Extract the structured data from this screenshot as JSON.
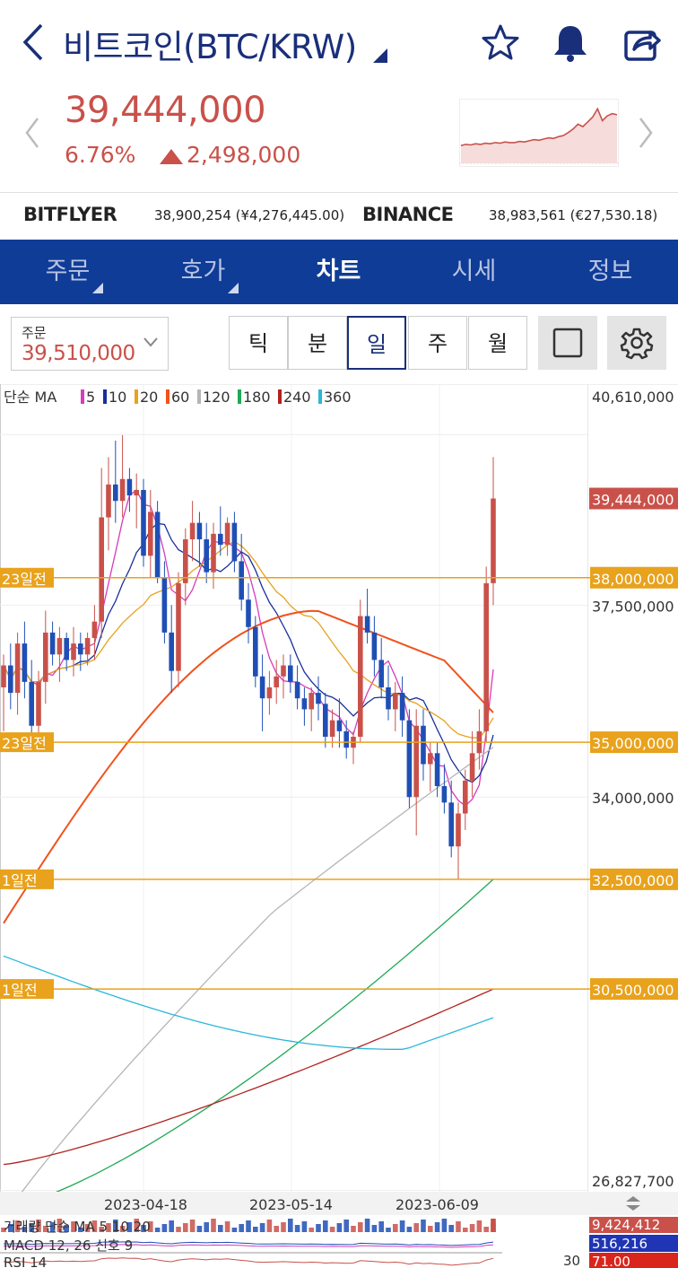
{
  "header": {
    "back_icon": "chevron-left-icon",
    "title": "비트코인(BTC/KRW)",
    "icons": [
      "star-icon",
      "bell-icon",
      "share-icon"
    ],
    "color": "#1a2f7a"
  },
  "price": {
    "current": "39,444,000",
    "change_pct": "6.76%",
    "change_amount": "2,498,000",
    "up_color": "#c9514a"
  },
  "exchanges": [
    {
      "name": "BITFLYER",
      "value": "38,900,254 (¥4,276,445.00)"
    },
    {
      "name": "BINANCE",
      "value": "38,983,561 (€27,530.18)"
    }
  ],
  "tabs": [
    {
      "label": "주문",
      "caret": true
    },
    {
      "label": "호가",
      "caret": true
    },
    {
      "label": "차트",
      "active": true
    },
    {
      "label": "시세"
    },
    {
      "label": "정보"
    }
  ],
  "order_select": {
    "label": "주문",
    "value": "39,510,000"
  },
  "periods": [
    {
      "label": "틱"
    },
    {
      "label": "분"
    },
    {
      "label": "일",
      "selected": true
    },
    {
      "label": "주"
    },
    {
      "label": "월"
    }
  ],
  "tool_icons": [
    "square-icon",
    "gear-icon"
  ],
  "chart_data": {
    "type": "candlestick",
    "legend": {
      "prefix": "단순 MA",
      "items": [
        {
          "label": "5",
          "color": "#d63bbd"
        },
        {
          "label": "10",
          "color": "#1a2f9a"
        },
        {
          "label": "20",
          "color": "#e8a21c"
        },
        {
          "label": "60",
          "color": "#f0521c"
        },
        {
          "label": "120",
          "color": "#b5b5b5"
        },
        {
          "label": "180",
          "color": "#1faa55"
        },
        {
          "label": "240",
          "color": "#b0231e"
        },
        {
          "label": "360",
          "color": "#2ab7d8"
        }
      ]
    },
    "y_labels": [
      {
        "text": "40,610,000",
        "value": 40610000
      },
      {
        "text": "37,500,000",
        "value": 37500000
      },
      {
        "text": "34,000,000",
        "value": 34000000
      },
      {
        "text": "26,827,700",
        "value": 26827700
      }
    ],
    "current_price": {
      "text": "39,444,000",
      "value": 39444000
    },
    "price_lines": [
      {
        "left": "23일전",
        "right": "38,000,000",
        "value": 38000000
      },
      {
        "left": "23일전",
        "right": "35,000,000",
        "value": 35000000
      },
      {
        "left": "1일전",
        "right": "32,500,000",
        "value": 32500000
      },
      {
        "left": "1일전",
        "right": "30,500,000",
        "value": 30500000
      }
    ],
    "x_labels": [
      "2023-04-18",
      "2023-05-14",
      "2023-06-09"
    ],
    "candles": [
      [
        36.0,
        36.6,
        35.2,
        36.4
      ],
      [
        36.4,
        36.8,
        35.6,
        35.9
      ],
      [
        35.9,
        37.0,
        35.5,
        36.8
      ],
      [
        36.8,
        37.2,
        35.8,
        36.1
      ],
      [
        36.1,
        36.5,
        35.0,
        35.3
      ],
      [
        35.3,
        36.3,
        34.9,
        36.1
      ],
      [
        36.1,
        37.4,
        35.7,
        37.0
      ],
      [
        37.0,
        37.2,
        36.4,
        36.6
      ],
      [
        36.6,
        37.1,
        36.1,
        36.9
      ],
      [
        36.9,
        37.0,
        36.3,
        36.5
      ],
      [
        36.5,
        37.1,
        36.2,
        36.8
      ],
      [
        36.8,
        37.0,
        36.3,
        36.6
      ],
      [
        36.6,
        37.0,
        36.4,
        36.9
      ],
      [
        36.9,
        37.5,
        36.5,
        37.2
      ],
      [
        37.2,
        40.0,
        36.9,
        39.1
      ],
      [
        39.1,
        40.2,
        38.5,
        39.7
      ],
      [
        39.7,
        40.5,
        39.0,
        39.4
      ],
      [
        39.4,
        40.6,
        39.1,
        39.8
      ],
      [
        39.8,
        40.0,
        39.2,
        39.5
      ],
      [
        39.5,
        39.9,
        38.9,
        39.6
      ],
      [
        39.6,
        39.8,
        38.2,
        38.4
      ],
      [
        38.4,
        39.6,
        38.0,
        39.2
      ],
      [
        39.2,
        39.4,
        37.9,
        38.0
      ],
      [
        38.0,
        38.3,
        36.8,
        37.0
      ],
      [
        37.0,
        37.5,
        35.9,
        36.3
      ],
      [
        36.3,
        38.1,
        36.0,
        37.9
      ],
      [
        37.9,
        38.9,
        37.5,
        38.7
      ],
      [
        38.7,
        39.4,
        38.3,
        39.0
      ],
      [
        39.0,
        39.2,
        38.2,
        38.7
      ],
      [
        38.7,
        39.0,
        37.9,
        38.1
      ],
      [
        38.1,
        39.0,
        37.8,
        38.8
      ],
      [
        38.8,
        39.3,
        38.4,
        38.6
      ],
      [
        38.6,
        39.1,
        38.4,
        39.0
      ],
      [
        39.0,
        39.2,
        38.1,
        38.3
      ],
      [
        38.3,
        38.8,
        37.4,
        37.6
      ],
      [
        37.6,
        37.9,
        36.8,
        37.1
      ],
      [
        37.1,
        37.3,
        36.0,
        36.2
      ],
      [
        36.2,
        36.6,
        35.2,
        35.8
      ],
      [
        35.8,
        36.3,
        35.5,
        36.0
      ],
      [
        36.0,
        36.5,
        35.7,
        36.2
      ],
      [
        36.2,
        36.6,
        35.8,
        36.4
      ],
      [
        36.4,
        36.6,
        35.9,
        36.1
      ],
      [
        36.1,
        36.4,
        35.6,
        35.8
      ],
      [
        35.8,
        36.0,
        35.3,
        35.6
      ],
      [
        35.6,
        36.0,
        35.2,
        35.9
      ],
      [
        35.9,
        36.2,
        35.4,
        35.7
      ],
      [
        35.7,
        35.9,
        34.9,
        35.1
      ],
      [
        35.1,
        35.6,
        34.9,
        35.4
      ],
      [
        35.4,
        35.8,
        34.9,
        35.2
      ],
      [
        35.2,
        35.4,
        34.7,
        34.9
      ],
      [
        34.9,
        35.2,
        34.6,
        35.1
      ],
      [
        35.1,
        37.6,
        35.0,
        37.3
      ],
      [
        37.3,
        37.8,
        36.8,
        37.0
      ],
      [
        37.0,
        37.3,
        36.2,
        36.5
      ],
      [
        36.5,
        36.9,
        35.8,
        36.0
      ],
      [
        36.0,
        36.4,
        35.4,
        35.6
      ],
      [
        35.6,
        36.1,
        35.2,
        35.9
      ],
      [
        35.9,
        36.2,
        35.1,
        35.4
      ],
      [
        35.4,
        35.6,
        33.8,
        34.0
      ],
      [
        34.0,
        35.6,
        33.3,
        35.3
      ],
      [
        35.3,
        35.6,
        34.3,
        34.6
      ],
      [
        34.6,
        35.0,
        34.1,
        34.8
      ],
      [
        34.8,
        35.0,
        34.0,
        34.2
      ],
      [
        34.2,
        34.6,
        33.7,
        33.9
      ],
      [
        33.9,
        34.3,
        32.9,
        33.1
      ],
      [
        33.1,
        33.9,
        32.5,
        33.7
      ],
      [
        33.7,
        34.5,
        33.4,
        34.3
      ],
      [
        34.3,
        35.2,
        34.0,
        34.8
      ],
      [
        34.8,
        35.6,
        34.5,
        35.2
      ],
      [
        35.2,
        38.2,
        35.0,
        37.9
      ],
      [
        37.9,
        40.2,
        37.5,
        39.444
      ]
    ],
    "indicator_labels": [
      {
        "text": "거래량 단순 MA 5 10 20",
        "value": "9,424,412"
      },
      {
        "text": "MACD 12, 26 신호 9",
        "value": "516,216"
      },
      {
        "text": "RSI 14",
        "value": "71.00",
        "level": "30"
      }
    ]
  }
}
